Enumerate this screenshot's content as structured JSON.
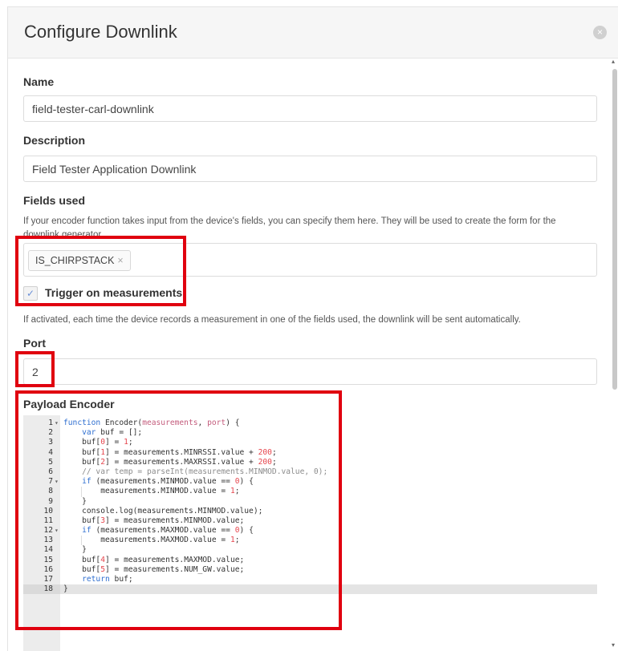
{
  "dialog": {
    "title": "Configure Downlink",
    "close_icon": "×"
  },
  "form": {
    "name": {
      "label": "Name",
      "value": "field-tester-carl-downlink"
    },
    "description": {
      "label": "Description",
      "value": "Field Tester Application Downlink"
    },
    "fields_used": {
      "label": "Fields used",
      "help_line1": "If your encoder function takes input from the device's fields, you can specify them here. They will be used to create the form for the",
      "help_line2": "downlink generator.",
      "tags": [
        "IS_CHIRPSTACK"
      ],
      "tag_remove_icon": "×"
    },
    "trigger": {
      "checked": true,
      "check_icon": "✓",
      "label": "Trigger on measurements",
      "help": "If activated, each time the device records a measurement in one of the fields used, the downlink will be sent automatically."
    },
    "port": {
      "label": "Port",
      "value": "2"
    },
    "payload_encoder": {
      "label": "Payload Encoder",
      "lines": [
        "function Encoder(measurements, port) {",
        "    var buf = [];",
        "    buf[0] = 1;",
        "    buf[1] = measurements.MINRSSI.value + 200;",
        "    buf[2] = measurements.MAXRSSI.value + 200;",
        "    // var temp = parseInt(measurements.MINMOD.value, 0);",
        "    if (measurements.MINMOD.value == 0) {",
        "        measurements.MINMOD.value = 1;",
        "    }",
        "    console.log(measurements.MINMOD.value);",
        "    buf[3] = measurements.MINMOD.value;",
        "    if (measurements.MAXMOD.value == 0) {",
        "        measurements.MAXMOD.value = 1;",
        "    }",
        "    buf[4] = measurements.MAXMOD.value;",
        "    buf[5] = measurements.NUM_GW.value;",
        "    return buf;",
        "}"
      ],
      "line_numbers": [
        "1",
        "2",
        "3",
        "4",
        "5",
        "6",
        "7",
        "8",
        "9",
        "10",
        "11",
        "12",
        "13",
        "14",
        "15",
        "16",
        "17",
        "18"
      ],
      "fold_markers": {
        "1": "▾",
        "7": "▾",
        "12": "▾"
      },
      "active_line": 18
    }
  },
  "highlight_color": "#e0000f",
  "colors": {
    "keyword": "#2f6fd0",
    "number": "#e6454d",
    "comment": "#8c8c8c"
  }
}
